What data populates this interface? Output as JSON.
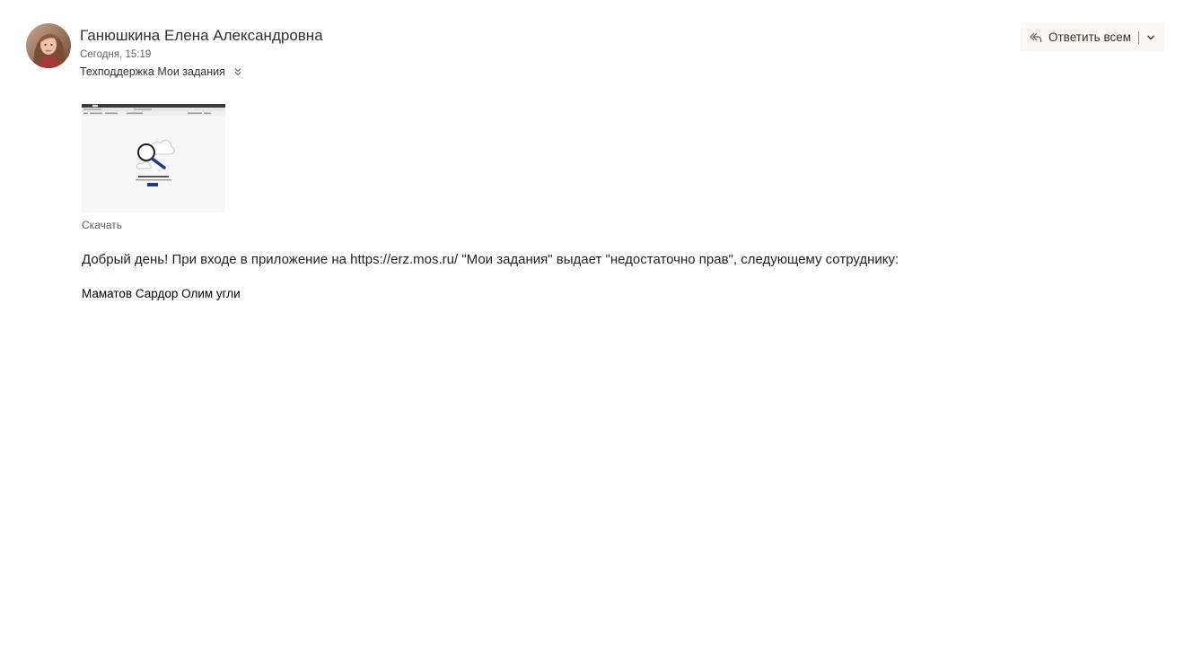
{
  "message": {
    "sender_name": "Ганюшкина Елена Александровна",
    "sent_time": "Сегодня, 15:19",
    "recipients": "Техподдержка Мои задания",
    "actions": {
      "reply_all_label": "Ответить всем"
    },
    "attachment": {
      "download_label": "Скачать"
    },
    "body": {
      "line1": "Добрый день! При входе в приложение на https://erz.mos.ru/ \"Мои задания\" выдает \"недостаточно прав\",  следующему сотруднику:",
      "line2": "Маматов Сардор Олим угли"
    }
  },
  "icons": {
    "reply_all": "reply-all-icon",
    "dropdown": "chevron-down-icon",
    "expand_recipients": "double-chevron-down-icon"
  },
  "colors": {
    "reply_button_bg": "#fdf6f1",
    "text_primary": "#323130",
    "text_secondary": "#605e5c",
    "thumbnail_button": "#1a3a8f"
  }
}
